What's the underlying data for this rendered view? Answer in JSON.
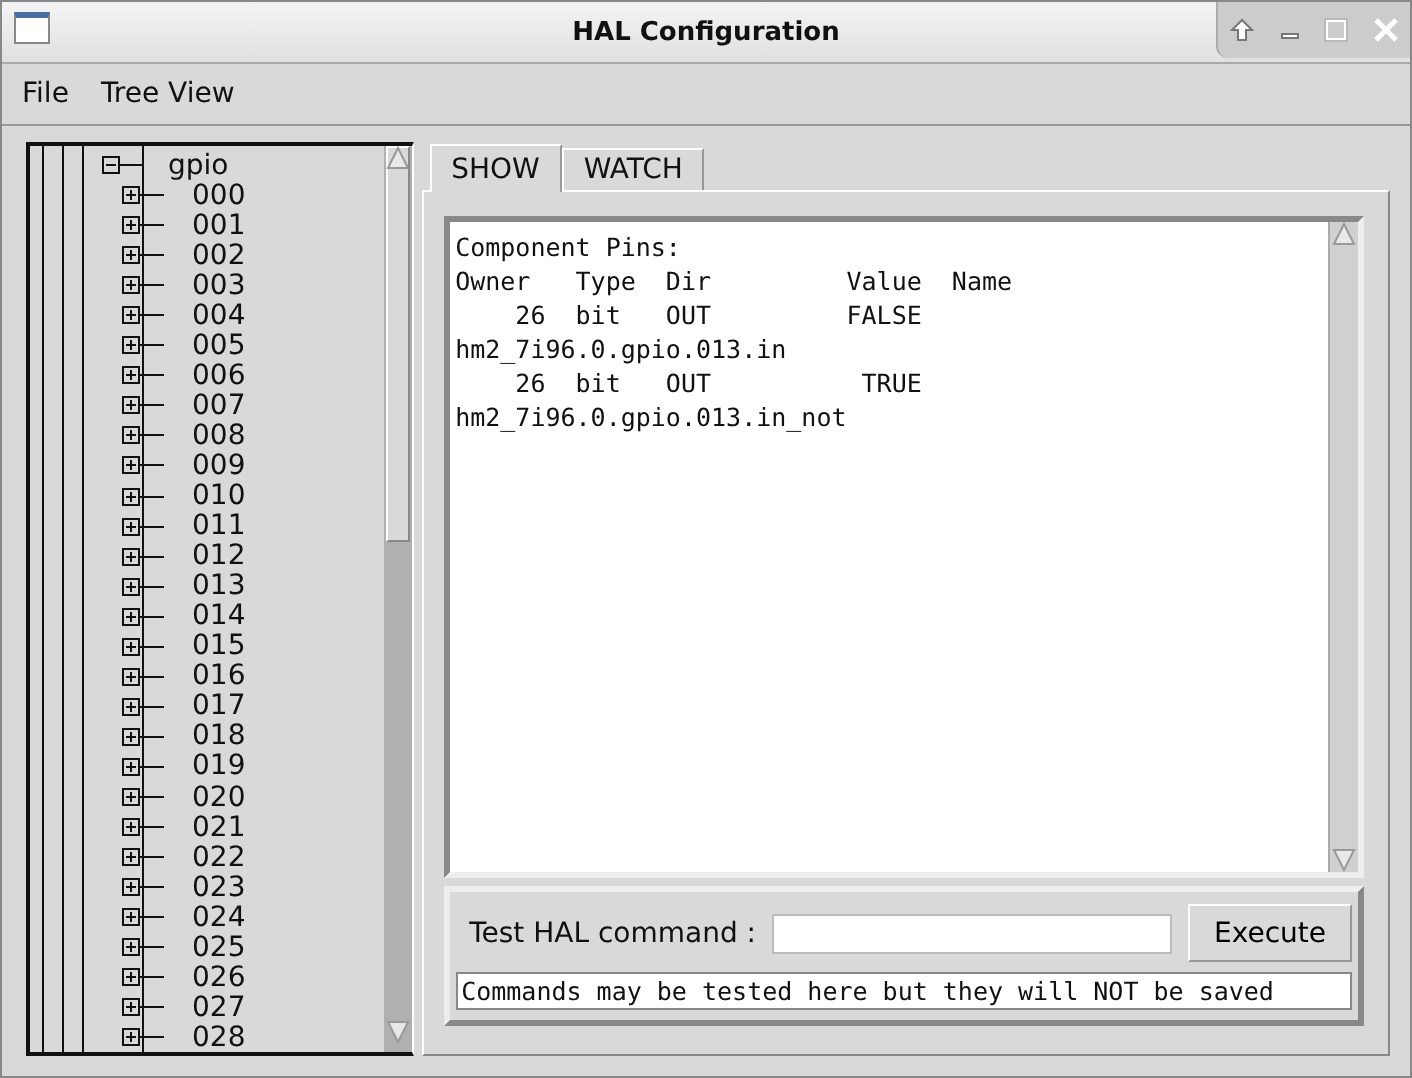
{
  "window": {
    "title": "HAL Configuration"
  },
  "menu": [
    "File",
    "Tree View"
  ],
  "tree": {
    "items": [
      {
        "label": "gpio",
        "expanded": true,
        "children": [
          {
            "label": "000",
            "expanded": false
          },
          {
            "label": "001",
            "expanded": false
          },
          {
            "label": "002",
            "expanded": false
          },
          {
            "label": "003",
            "expanded": false
          },
          {
            "label": "004",
            "expanded": false
          },
          {
            "label": "005",
            "expanded": false
          },
          {
            "label": "006",
            "expanded": false
          },
          {
            "label": "007",
            "expanded": false
          },
          {
            "label": "008",
            "expanded": false
          },
          {
            "label": "009",
            "expanded": false
          },
          {
            "label": "010",
            "expanded": false
          },
          {
            "label": "011",
            "expanded": false
          },
          {
            "label": "012",
            "expanded": false
          },
          {
            "label": "013",
            "expanded": false
          },
          {
            "label": "014",
            "expanded": false
          },
          {
            "label": "015",
            "expanded": false
          },
          {
            "label": "016",
            "expanded": false
          },
          {
            "label": "017",
            "expanded": false
          },
          {
            "label": "018",
            "expanded": false
          },
          {
            "label": "019",
            "expanded": false
          },
          {
            "label": "020",
            "expanded": false
          },
          {
            "label": "021",
            "expanded": false
          },
          {
            "label": "022",
            "expanded": false
          },
          {
            "label": "023",
            "expanded": false
          },
          {
            "label": "024",
            "expanded": false
          },
          {
            "label": "025",
            "expanded": false
          },
          {
            "label": "026",
            "expanded": false
          },
          {
            "label": "027",
            "expanded": false
          },
          {
            "label": "028",
            "expanded": false
          }
        ]
      }
    ]
  },
  "tabs": [
    {
      "label": "SHOW",
      "selected": true
    },
    {
      "label": "WATCH",
      "selected": false
    }
  ],
  "output": {
    "lines": [
      "Component Pins:",
      "Owner   Type  Dir         Value  Name",
      "    26  bit   OUT         FALSE",
      "hm2_7i96.0.gpio.013.in",
      "    26  bit   OUT          TRUE",
      "hm2_7i96.0.gpio.013.in_not"
    ]
  },
  "command": {
    "label": "Test HAL command :",
    "button": "Execute",
    "note": "Commands may be tested here but they will NOT be saved"
  }
}
